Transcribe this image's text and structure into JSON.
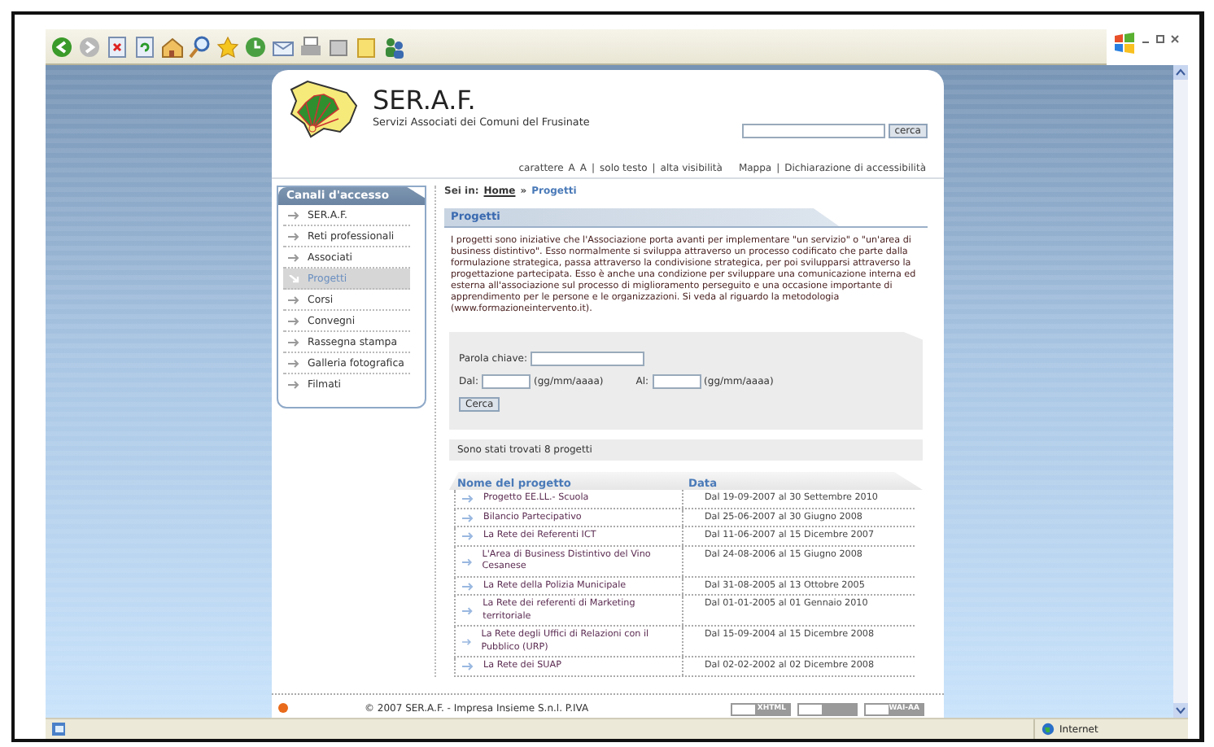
{
  "status_bar": {
    "zone": "Internet"
  },
  "site": {
    "title": "SER.A.F.",
    "subtitle": "Servizi Associati dei Comuni del Frusinate",
    "search": {
      "button": "cerca"
    },
    "tools": {
      "separator": "|",
      "left": [
        {
          "label": "carattere"
        },
        {
          "label": "A"
        },
        {
          "label": "A"
        }
      ],
      "links": [
        "solo testo",
        "alta visibilità"
      ],
      "right": [
        "Mappa",
        "Dichiarazione di accessibilità"
      ]
    },
    "breadcrumb": {
      "label": "Sei in:",
      "separator": "»",
      "items": [
        "Home",
        "Progetti"
      ]
    },
    "nav": {
      "title": "Canali d'accesso",
      "items": [
        {
          "label": "SER.A.F.",
          "selected": false
        },
        {
          "label": "Reti professionali",
          "selected": false
        },
        {
          "label": "Associati",
          "selected": false
        },
        {
          "label": "Progetti",
          "selected": true
        },
        {
          "label": "Corsi",
          "selected": false
        },
        {
          "label": "Convegni",
          "selected": false
        },
        {
          "label": "Rassegna stampa",
          "selected": false
        },
        {
          "label": "Galleria fotografica",
          "selected": false
        },
        {
          "label": "Filmati",
          "selected": false
        }
      ]
    },
    "heading": "Progetti",
    "intro": "I progetti sono iniziative che l'Associazione porta avanti per implementare \"un servizio\" o \"un'area di business distintivo\". Esso normalmente si sviluppa attraverso un processo codificato che parte dalla formulazione strategica, passa attraverso la condivisione strategica, per poi svilupparsi attraverso la progettazione partecipata. Esso è anche una condizione per sviluppare una comunicazione interna ed esterna all'associazione sul processo di miglioramento perseguito e una occasione importante di apprendimento per le persone e le organizzazioni. Si veda al riguardo la metodologia (www.formazioneintervento.it).",
    "form": {
      "keyword_label": "Parola chiave:",
      "from_label": "Dal:",
      "from_hint": "(gg/mm/aaaa)",
      "to_label": "Al:",
      "to_hint": "(gg/mm/aaaa)",
      "button": "Cerca"
    },
    "result": "Sono stati trovati 8 progetti",
    "table": {
      "columns": [
        "Nome del progetto",
        "Data"
      ],
      "rows": [
        {
          "name": "Progetto EE.LL.- Scuola",
          "date": "Dal 19-09-2007 al 30 Settembre 2010"
        },
        {
          "name": "Bilancio Partecipativo",
          "date": "Dal 25-06-2007 al 30 Giugno 2008"
        },
        {
          "name": "La Rete dei Referenti ICT",
          "date": "Dal 11-06-2007 al 15 Dicembre 2007"
        },
        {
          "name": "L'Area di Business Distintivo del Vino Cesanese",
          "date": "Dal 24-08-2006 al 15 Giugno 2008"
        },
        {
          "name": "La Rete della Polizia Municipale",
          "date": "Dal 31-08-2005 al 13 Ottobre 2005"
        },
        {
          "name": "La Rete dei referenti di Marketing territoriale",
          "date": "Dal 01-01-2005 al 01 Gennaio 2010"
        },
        {
          "name": "La Rete degli Uffici di Relazioni con il Pubblico (URP)",
          "date": "Dal 15-09-2004 al 15 Dicembre 2008"
        },
        {
          "name": "La Rete dei SUAP",
          "date": "Dal 02-02-2002 al 02 Dicembre 2008"
        }
      ]
    },
    "footer": {
      "copyright": "© 2007 SER.A.F. - Impresa Insieme S.n.l. P.IVA",
      "badges": [
        "XHTML",
        "WAI-AA"
      ]
    }
  }
}
